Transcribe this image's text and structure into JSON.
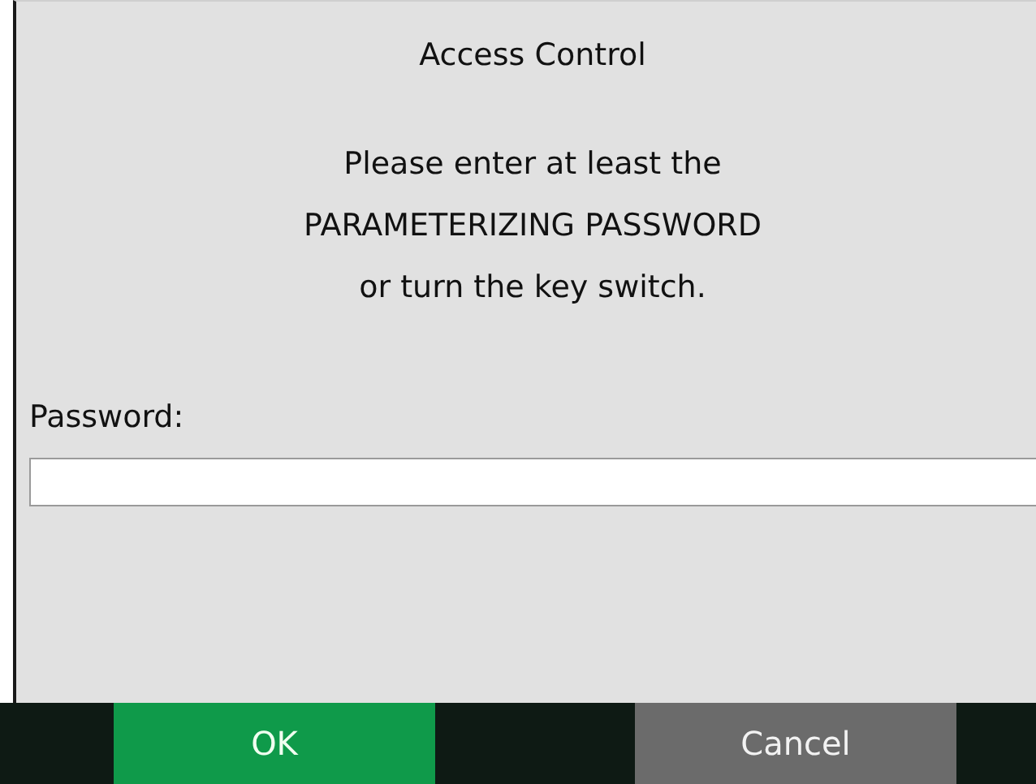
{
  "dialog": {
    "title": "Access Control",
    "message": [
      "Please enter at least the",
      "PARAMETERIZING PASSWORD",
      "or turn the key switch."
    ],
    "password": {
      "label": "Password:"
    }
  },
  "buttons": [
    {
      "label": "OK",
      "kind": "primary"
    },
    {
      "label": "Cancel",
      "kind": "secondary"
    }
  ]
}
